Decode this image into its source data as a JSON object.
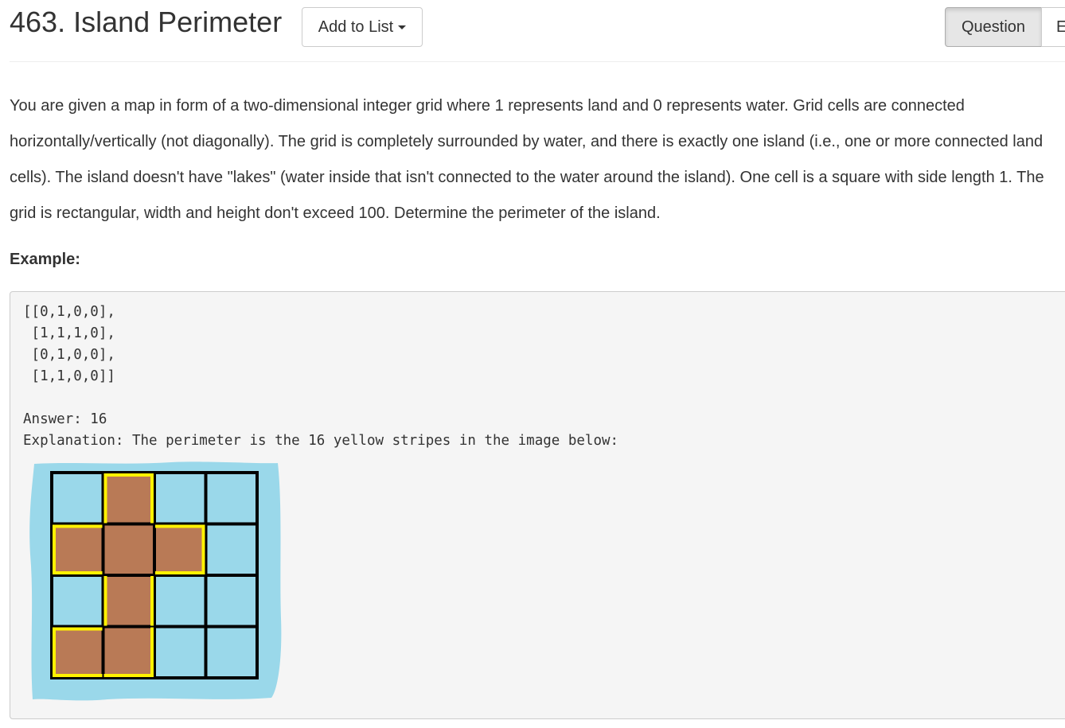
{
  "header": {
    "title": "463. Island Perimeter",
    "add_to_list_label": "Add to List",
    "tabs": [
      {
        "label": "Question",
        "active": true
      },
      {
        "label": "E",
        "active": false
      }
    ]
  },
  "problem": {
    "description": "You are given a map in form of a two-dimensional integer grid where 1 represents land and 0 represents water. Grid cells are connected horizontally/vertically (not diagonally). The grid is completely surrounded by water, and there is exactly one island (i.e., one or more connected land cells). The island doesn't have \"lakes\" (water inside that isn't connected to the water around the island). One cell is a square with side length 1. The grid is rectangular, width and height don't exceed 100. Determine the perimeter of the island.",
    "example_heading": "Example:",
    "example_code": "[[0,1,0,0],\n [1,1,1,0],\n [0,1,0,0],\n [1,1,0,0]]\n\nAnswer: 16\nExplanation: The perimeter is the 16 yellow stripes in the image below:"
  },
  "figure": {
    "grid": [
      [
        0,
        1,
        0,
        0
      ],
      [
        1,
        1,
        1,
        0
      ],
      [
        0,
        1,
        0,
        0
      ],
      [
        1,
        1,
        0,
        0
      ]
    ],
    "colors": {
      "water": "#9ad8ea",
      "land": "#b97a56",
      "grid_line": "#000000",
      "perimeter": "#fff200"
    }
  }
}
